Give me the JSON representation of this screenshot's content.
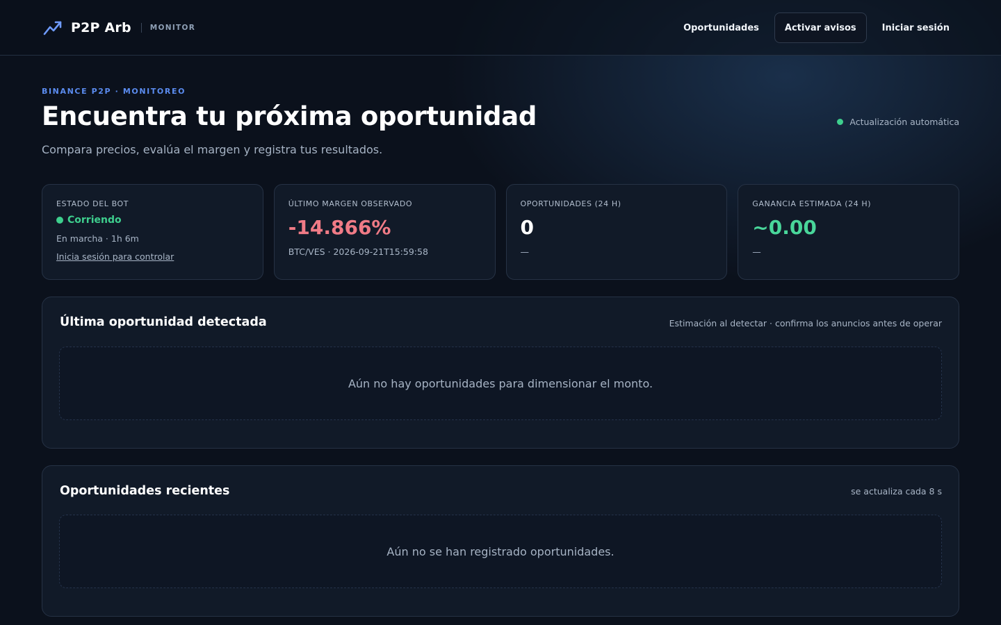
{
  "header": {
    "brand_name": "P2P Arb",
    "brand_tag": "MONITOR",
    "nav": [
      {
        "label": "Oportunidades"
      },
      {
        "label": "Activar avisos"
      },
      {
        "label": "Iniciar sesión"
      }
    ],
    "brand_icon": "trending-up-icon"
  },
  "hero": {
    "eyebrow": "BINANCE P2P · MONITOREO",
    "title": "Encuentra tu próxima oportunidad",
    "subtitle": "Compara precios, evalúa el margen y registra tus resultados.",
    "auto_update": "Actualización automática"
  },
  "stats": {
    "bot": {
      "label": "ESTADO DEL BOT",
      "status": "Corriendo",
      "uptime": "En marcha · 1h 6m",
      "login_link": "Inicia sesión para controlar"
    },
    "margin": {
      "label": "ÚLTIMO MARGEN OBSERVADO",
      "value": "-14.866%",
      "meta": "BTC/VES · 2026-09-21T15:59:58"
    },
    "opportunities": {
      "label": "OPORTUNIDADES (24 H)",
      "value": "0",
      "meta": "—"
    },
    "profit": {
      "label": "GANANCIA ESTIMADA (24 H)",
      "value": "~0.00",
      "meta": "—"
    }
  },
  "last_opportunity": {
    "title": "Última oportunidad detectada",
    "note": "Estimación al detectar · confirma los anuncios antes de operar",
    "empty": "Aún no hay oportunidades para dimensionar el monto."
  },
  "recent": {
    "title": "Oportunidades recientes",
    "note": "se actualiza cada 8 s",
    "empty": "Aún no se han registrado oportunidades."
  },
  "colors": {
    "accent": "#5b8cf0",
    "positive": "#3ecf8e",
    "negative": "#f07b86",
    "background": "#0b111c",
    "card": "#111a28"
  }
}
